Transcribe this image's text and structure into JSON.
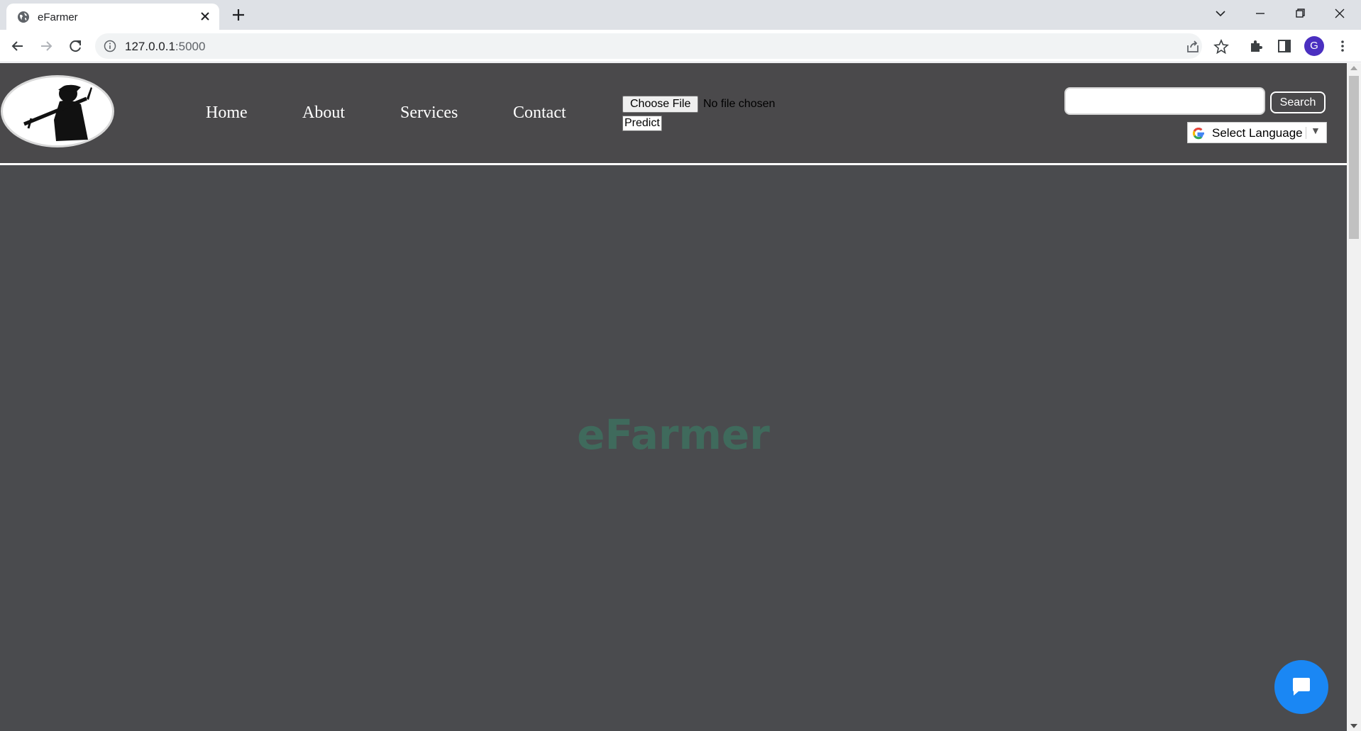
{
  "browser": {
    "tab": {
      "title": "eFarmer",
      "favicon": "globe-icon"
    },
    "url": {
      "host": "127.0.0.1",
      "port": ":5000"
    },
    "profile_initial": "G"
  },
  "header": {
    "logo": "farmer-silhouette-logo",
    "nav": [
      "Home",
      "About",
      "Services",
      "Contact"
    ],
    "file_input": {
      "button_label": "Choose File",
      "status": "No file chosen"
    },
    "predict_label": "Predict",
    "search": {
      "value": "",
      "button_label": "Search"
    },
    "language_select": {
      "label": "Select Language",
      "arrow": "▼"
    }
  },
  "hero": {
    "title": "eFarmer"
  },
  "colors": {
    "page_bg": "#4a4b4e",
    "header_bg": "#4a494b",
    "hero_text": "#3f6a5c",
    "chat_button": "#1a87f4"
  },
  "chat_widget": {
    "icon": "chat-bubble-icon"
  }
}
